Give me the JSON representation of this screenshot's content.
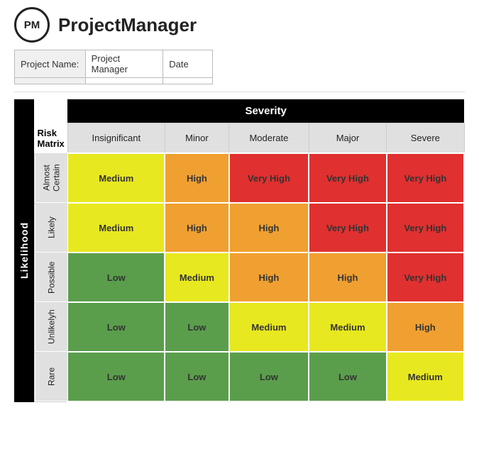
{
  "header": {
    "logo_text": "PM",
    "app_title": "ProjectManager"
  },
  "project_info": {
    "label_name": "Project Name:",
    "label_manager": "Project Manager",
    "label_date": "Date",
    "value_name": "",
    "value_manager": "",
    "value_date": ""
  },
  "matrix": {
    "likelihood_label": "Likelihood",
    "severity_label": "Severity",
    "risk_matrix_label": "Risk Matrix",
    "col_headers": [
      "Insignificant",
      "Minor",
      "Moderate",
      "Major",
      "Severe"
    ],
    "rows": [
      {
        "label": "Almost Certain",
        "cells": [
          {
            "value": "Medium",
            "class": "cell-medium"
          },
          {
            "value": "High",
            "class": "cell-high"
          },
          {
            "value": "Very High",
            "class": "cell-very-high"
          },
          {
            "value": "Very High",
            "class": "cell-very-high"
          },
          {
            "value": "Very High",
            "class": "cell-very-high"
          }
        ]
      },
      {
        "label": "Likely",
        "cells": [
          {
            "value": "Medium",
            "class": "cell-medium"
          },
          {
            "value": "High",
            "class": "cell-high"
          },
          {
            "value": "High",
            "class": "cell-high"
          },
          {
            "value": "Very High",
            "class": "cell-very-high"
          },
          {
            "value": "Very High",
            "class": "cell-very-high"
          }
        ]
      },
      {
        "label": "Possible",
        "cells": [
          {
            "value": "Low",
            "class": "cell-low"
          },
          {
            "value": "Medium",
            "class": "cell-medium"
          },
          {
            "value": "High",
            "class": "cell-high"
          },
          {
            "value": "High",
            "class": "cell-high"
          },
          {
            "value": "Very High",
            "class": "cell-very-high"
          }
        ]
      },
      {
        "label": "Unlikelyh",
        "cells": [
          {
            "value": "Low",
            "class": "cell-low"
          },
          {
            "value": "Low",
            "class": "cell-low"
          },
          {
            "value": "Medium",
            "class": "cell-medium"
          },
          {
            "value": "Medium",
            "class": "cell-medium"
          },
          {
            "value": "High",
            "class": "cell-high"
          }
        ]
      },
      {
        "label": "Rare",
        "cells": [
          {
            "value": "Low",
            "class": "cell-low"
          },
          {
            "value": "Low",
            "class": "cell-low"
          },
          {
            "value": "Low",
            "class": "cell-low"
          },
          {
            "value": "Low",
            "class": "cell-low"
          },
          {
            "value": "Medium",
            "class": "cell-medium"
          }
        ]
      }
    ]
  }
}
